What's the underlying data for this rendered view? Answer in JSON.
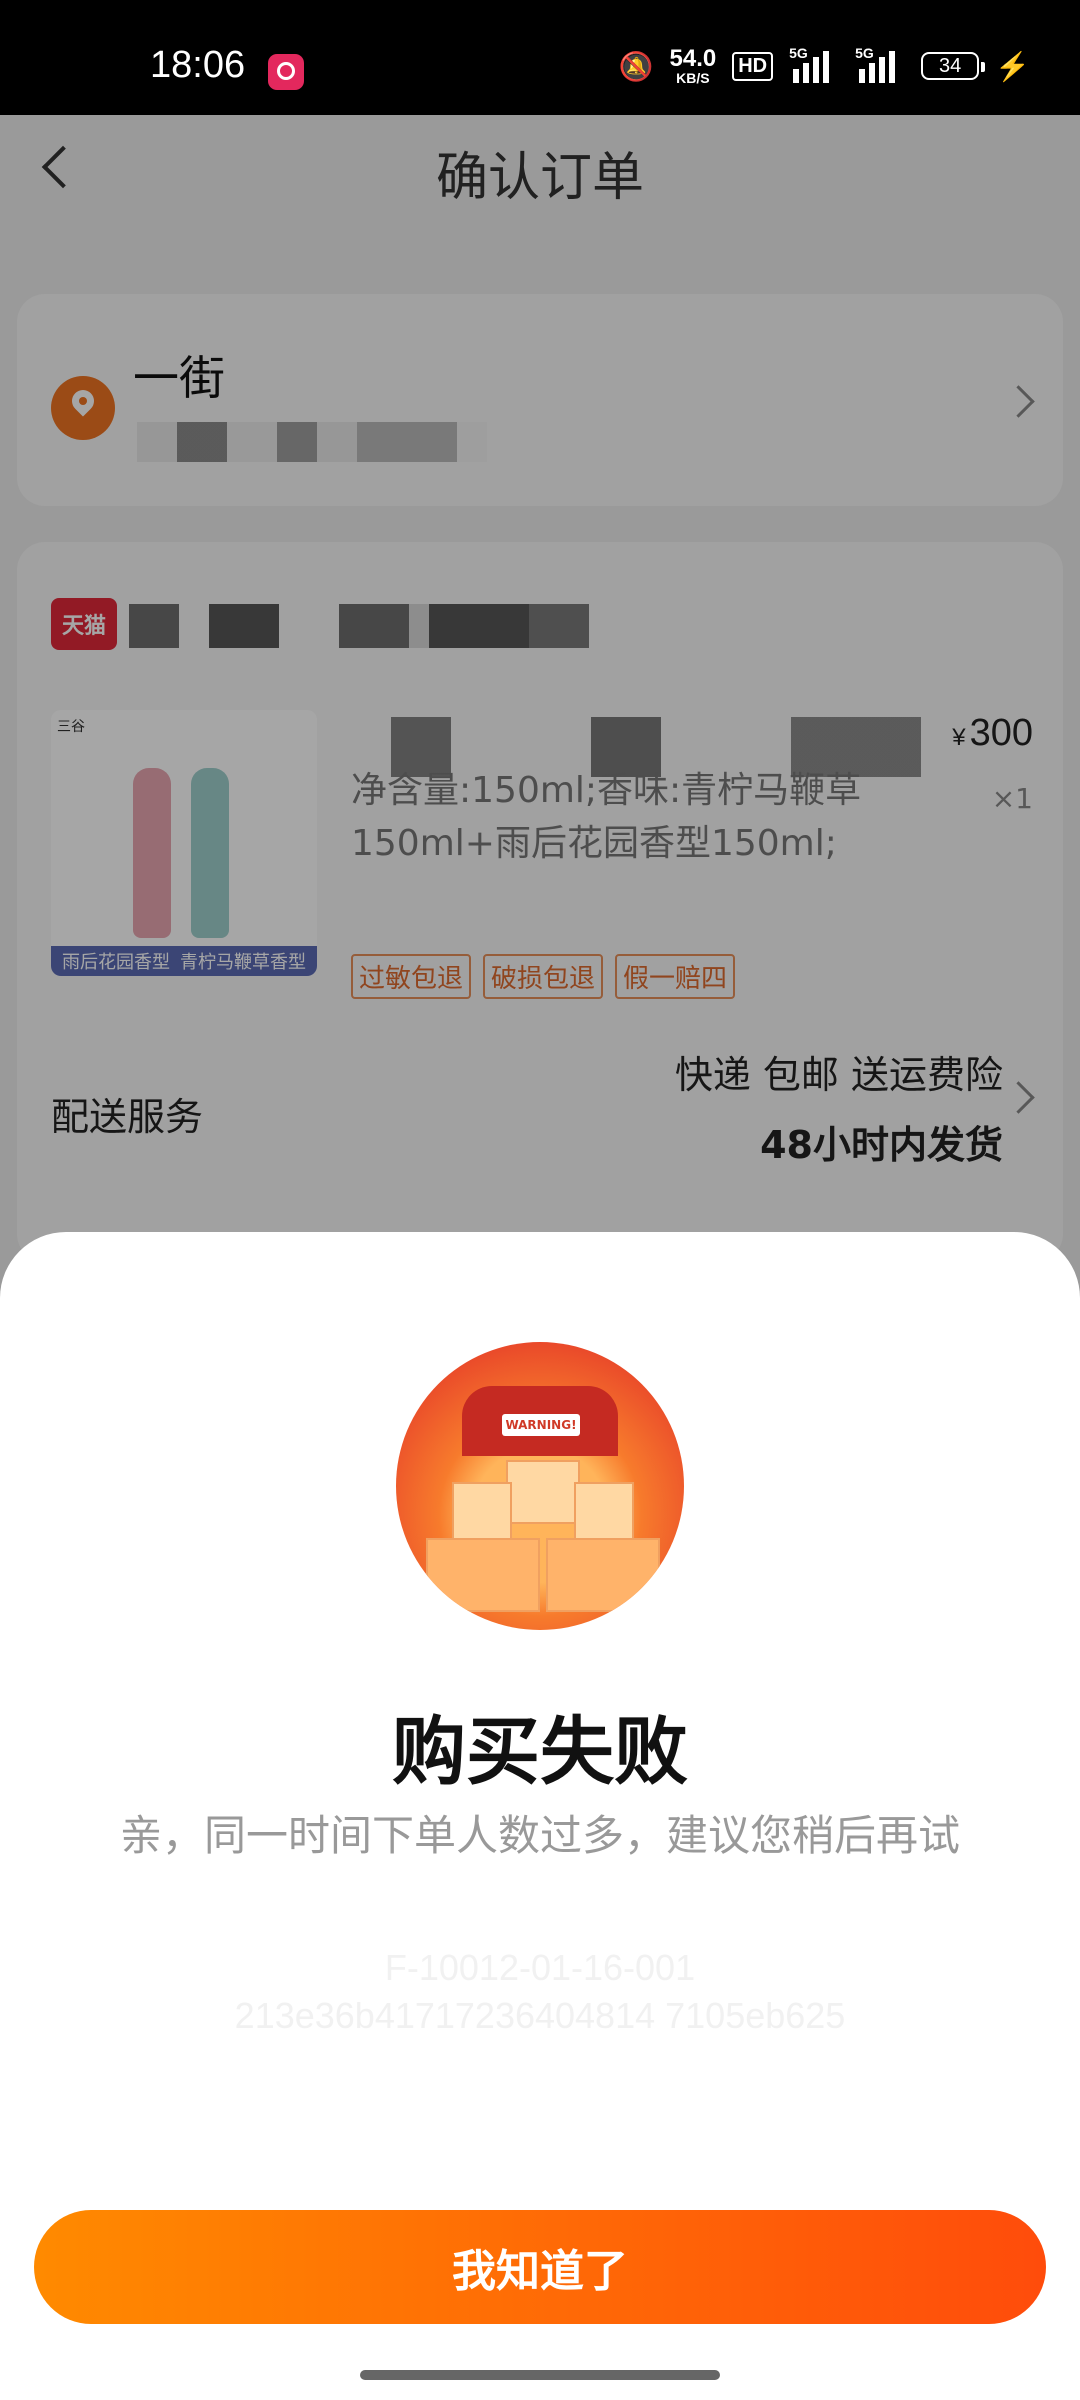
{
  "status_bar": {
    "time": "18:06",
    "net_speed": "54.0",
    "net_unit": "KB/S",
    "hd": "HD",
    "sig1": "5G",
    "sig2": "5G",
    "battery": "34"
  },
  "header": {
    "title": "确认订单"
  },
  "address": {
    "name": "一街"
  },
  "product": {
    "price_currency": "¥",
    "price": "300",
    "quantity": "×1",
    "spec": "净含量:150ml;香味:青柠马鞭草150ml+雨后花园香型150ml;",
    "image_brand": "三谷",
    "image_label_1": "雨后花园香型",
    "image_label_2": "青柠马鞭草香型",
    "tags": [
      "过敏包退",
      "破损包退",
      "假一赔四"
    ]
  },
  "shipping": {
    "label": "配送服务",
    "line1": "快递 包邮 送运费险",
    "line2": "48小时内发货"
  },
  "dialog": {
    "warning_sign": "WARNING!",
    "title": "购买失败",
    "message": "亲，同一时间下单人数过多，建议您稍后再试",
    "code_line1": "F-10012-01-16-001",
    "code_line2": "213e36b41717236404814 7105eb625",
    "button": "我知道了"
  }
}
